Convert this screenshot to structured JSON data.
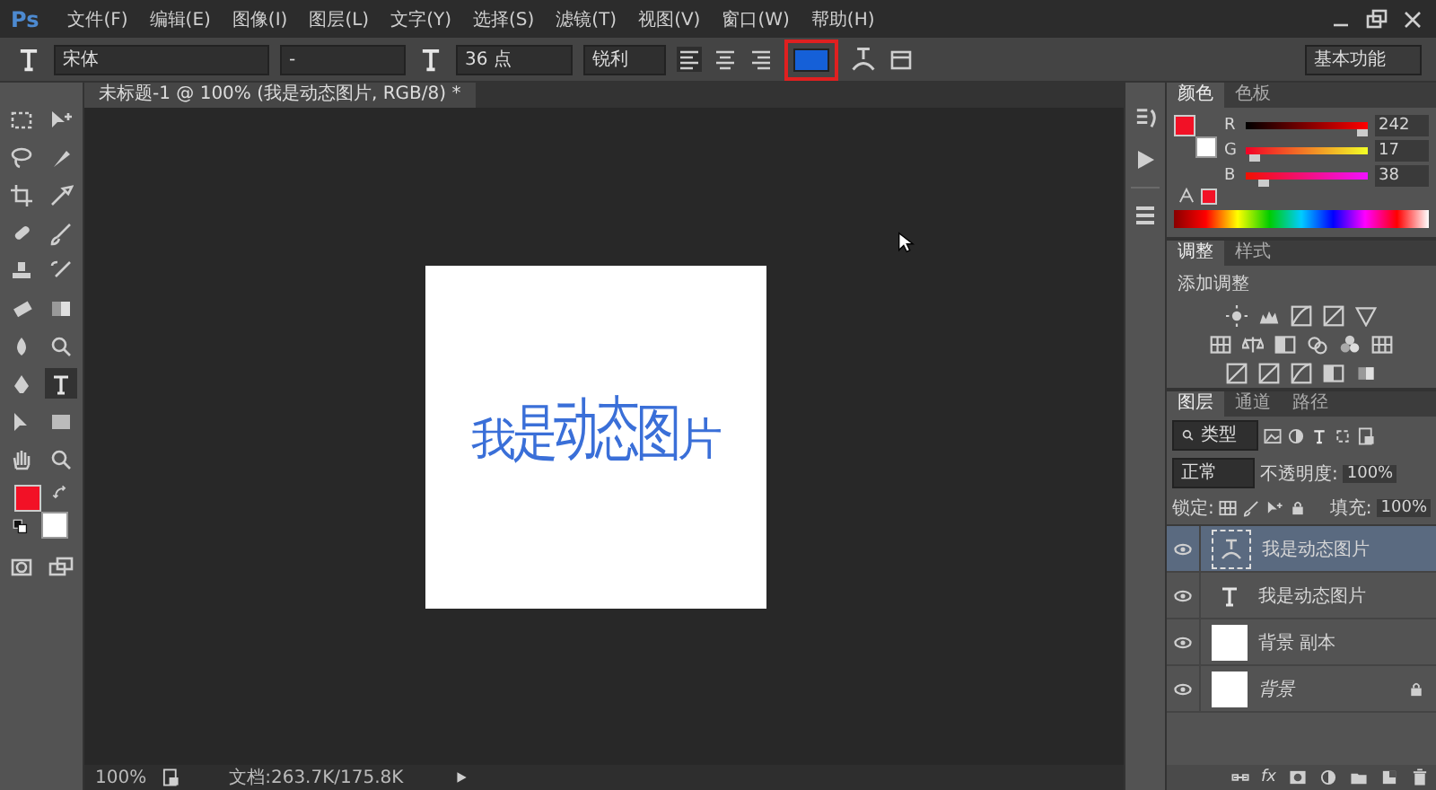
{
  "app": {
    "logo": "Ps"
  },
  "menu": [
    "文件(F)",
    "编辑(E)",
    "图像(I)",
    "图层(L)",
    "文字(Y)",
    "选择(S)",
    "滤镜(T)",
    "视图(V)",
    "窗口(W)",
    "帮助(H)"
  ],
  "options_bar": {
    "font_family": "宋体",
    "font_style": "-",
    "font_size": "36 点",
    "antialias": "锐利",
    "text_color": {
      "color": "#1560d8"
    },
    "color_highlighted": true,
    "workspace": "基本功能"
  },
  "document": {
    "tab_title": "未标题-1 @ 100% (我是动态图片, RGB/8) *",
    "canvas_text": "我是动态图片"
  },
  "tools": [
    {
      "selected": false
    },
    {
      "selected": false
    },
    {
      "selected": false
    },
    {
      "selected": false
    },
    {
      "selected": false
    },
    {
      "selected": false
    },
    {
      "selected": false
    },
    {
      "selected": false
    },
    {
      "selected": false
    },
    {
      "selected": false
    },
    {
      "selected": false
    },
    {
      "selected": false
    },
    {
      "selected": false
    },
    {
      "selected": false
    },
    {
      "selected": false
    },
    {
      "selected": true
    },
    {
      "selected": false
    },
    {
      "selected": false
    },
    {
      "selected": false
    },
    {
      "selected": false
    }
  ],
  "color_swatches": [
    {
      "kind": "foreground",
      "color": "#f21126"
    },
    {
      "kind": "background",
      "color": "#ffffff"
    }
  ],
  "color_panel": {
    "tabs": [
      {
        "label": "颜色",
        "selected": true
      },
      {
        "label": "色板",
        "selected": false
      }
    ],
    "channels": [
      {
        "name": "R",
        "value": "242",
        "level": 0.95
      },
      {
        "name": "G",
        "value": "17",
        "level": 0.07
      },
      {
        "name": "B",
        "value": "38",
        "level": 0.15
      }
    ]
  },
  "adjustments_panel": {
    "tabs": [
      {
        "label": "调整",
        "selected": true
      },
      {
        "label": "样式",
        "selected": false
      }
    ],
    "heading": "添加调整"
  },
  "layers_panel": {
    "tabs": [
      {
        "label": "图层",
        "selected": true
      },
      {
        "label": "通道",
        "selected": false
      },
      {
        "label": "路径",
        "selected": false
      }
    ],
    "filter": "类型",
    "blend_mode": "正常",
    "opacity_label": "不透明度:",
    "opacity": "100%",
    "lock_label": "锁定:",
    "fill_label": "填充:",
    "fill": "100%",
    "footer_fx": "fx",
    "layers": [
      {
        "name": "我是动态图片",
        "kind": "warped",
        "selected": true,
        "visible": true,
        "locked": false
      },
      {
        "name": "我是动态图片",
        "kind": "text",
        "selected": false,
        "visible": true,
        "locked": false
      },
      {
        "name": "背景 副本",
        "kind": "image",
        "selected": false,
        "visible": true,
        "locked": false
      },
      {
        "name": "背景",
        "kind": "image",
        "selected": false,
        "visible": true,
        "locked": true
      }
    ]
  },
  "status_bar": {
    "zoom": "100%",
    "doc_size": "文档:263.7K/175.8K"
  }
}
